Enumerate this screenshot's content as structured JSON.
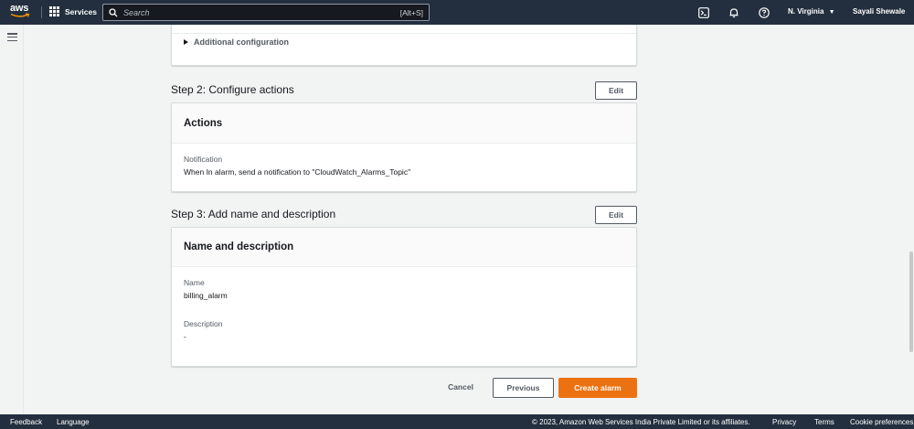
{
  "topnav": {
    "logo_text": "aws",
    "services_label": "Services",
    "search_placeholder": "Search",
    "search_shortcut": "[Alt+S]",
    "region_label": "N. Virginia",
    "user_label": "Sayali Shewale",
    "icons": [
      "cloudshell-icon",
      "notifications-bell-icon",
      "help-icon"
    ]
  },
  "step1": {
    "additional_configuration_label": "Additional configuration"
  },
  "step2": {
    "title": "Step 2: Configure actions",
    "edit_label": "Edit",
    "card_title": "Actions",
    "fields": [
      {
        "label": "Notification",
        "value": "When In alarm, send a notification to \"CloudWatch_Alarms_Topic\""
      }
    ]
  },
  "step3": {
    "title": "Step 3: Add name and description",
    "edit_label": "Edit",
    "card_title": "Name and description",
    "fields": [
      {
        "label": "Name",
        "value": "billing_alarm"
      },
      {
        "label": "Description",
        "value": "-"
      }
    ]
  },
  "actions": {
    "cancel_label": "Cancel",
    "previous_label": "Previous",
    "create_label": "Create alarm"
  },
  "footer": {
    "feedback_label": "Feedback",
    "language_label": "Language",
    "copyright": "© 2023, Amazon Web Services India Private Limited or its affiliates.",
    "privacy_label": "Privacy",
    "terms_label": "Terms",
    "cookie_label": "Cookie preferences"
  },
  "colors": {
    "nav_bg": "#232f3e",
    "page_bg": "#f2f3f3",
    "primary_button": "#ec7211",
    "text_secondary": "#545b64"
  }
}
